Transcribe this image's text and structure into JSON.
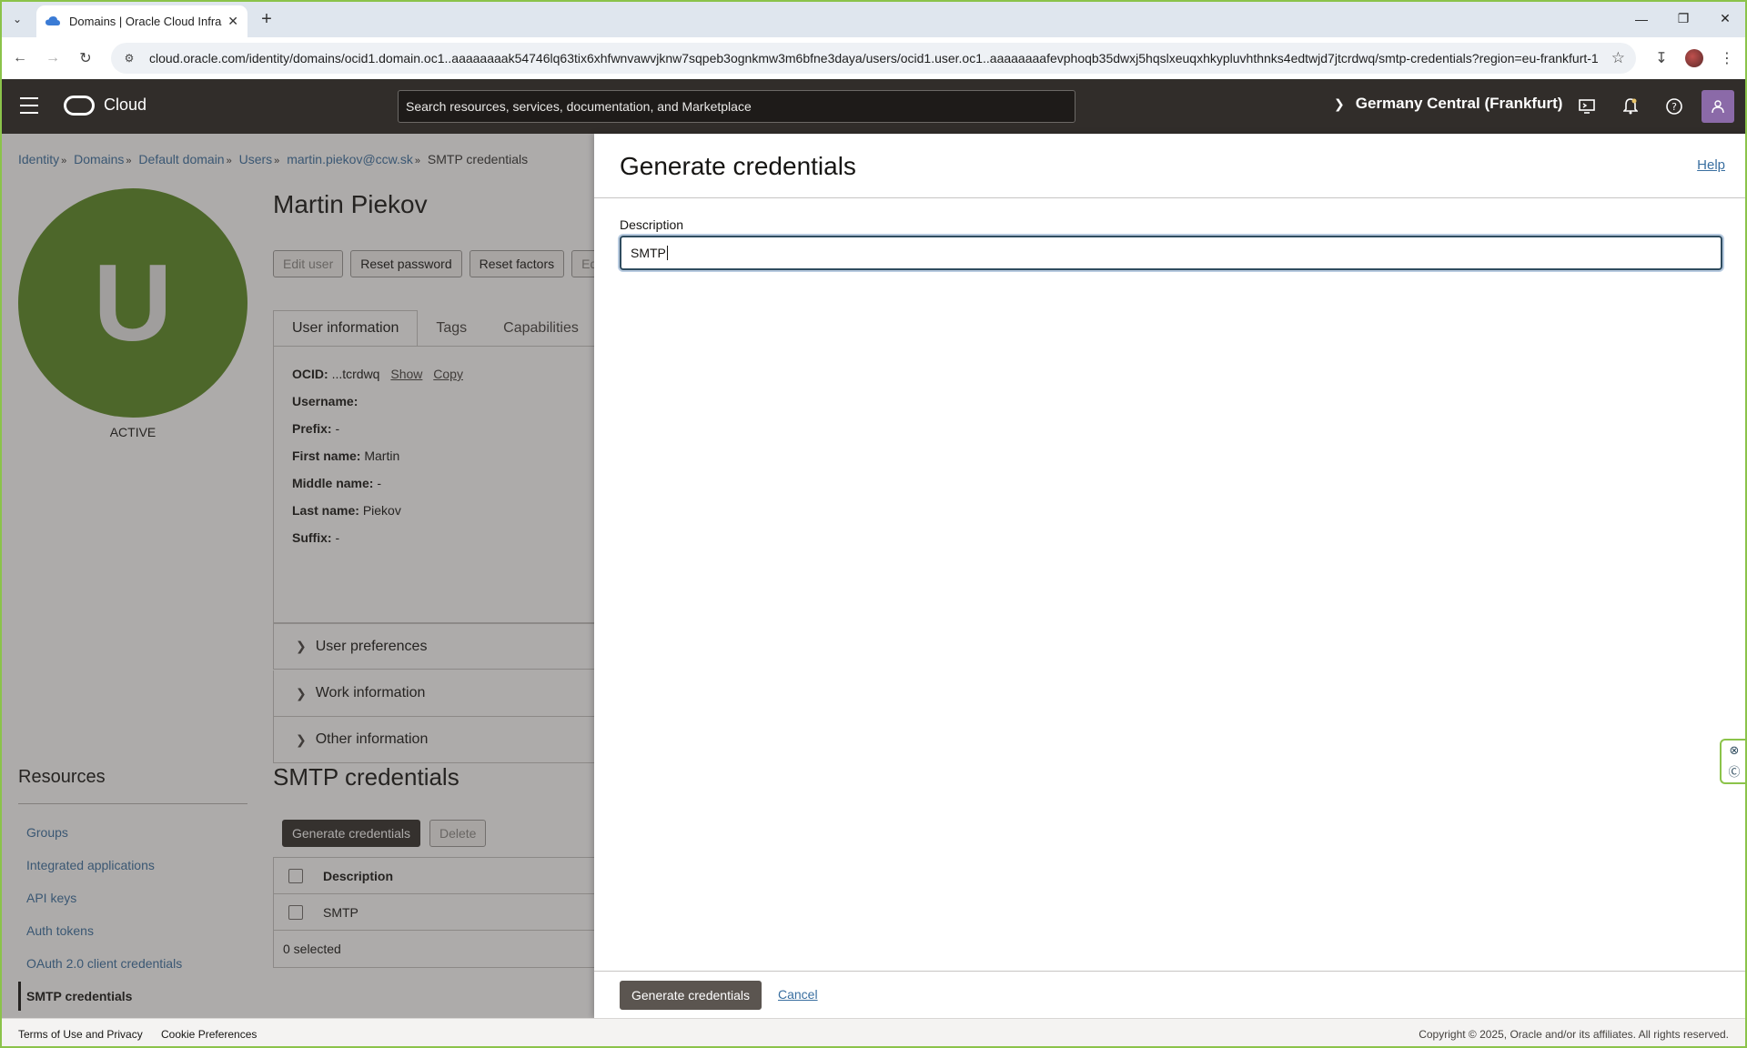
{
  "browser": {
    "tab_title": "Domains | Oracle Cloud Infrastr",
    "url": "cloud.oracle.com/identity/domains/ocid1.domain.oc1..aaaaaaaak54746lq63tix6xhfwnvawvjknw7sqpeb3ognkmw3m6bfne3daya/users/ocid1.user.oc1..aaaaaaaafevphoqb35dwxj5hqslxeuqxhkypluvhthnks4edtwjd7jtcrdwq/smtp-credentials?region=eu-frankfurt-1"
  },
  "header": {
    "brand": "Cloud",
    "search_placeholder": "Search resources, services, documentation, and Marketplace",
    "region": "Germany Central (Frankfurt)"
  },
  "breadcrumb": {
    "items": [
      "Identity",
      "Domains",
      "Default domain",
      "Users",
      "martin.piekov@ccw.sk"
    ],
    "current": "SMTP credentials"
  },
  "user": {
    "avatar_letter": "U",
    "status": "ACTIVE",
    "name": "Martin Piekov",
    "actions": [
      "Edit user",
      "Reset password",
      "Reset factors",
      "Ed"
    ],
    "tabs": [
      "User information",
      "Tags",
      "Capabilities"
    ],
    "info": {
      "ocid_label": "OCID:",
      "ocid_value": "...tcrdwq",
      "show": "Show",
      "copy": "Copy",
      "username_label": "Username:",
      "prefix_label": "Prefix:",
      "prefix_value": "-",
      "first_name_label": "First name:",
      "first_name_value": "Martin",
      "middle_name_label": "Middle name:",
      "middle_name_value": "-",
      "last_name_label": "Last name:",
      "last_name_value": "Piekov",
      "suffix_label": "Suffix:",
      "suffix_value": "-"
    },
    "sections": [
      "User preferences",
      "Work information",
      "Other information"
    ]
  },
  "resources": {
    "title": "Resources",
    "items": [
      "Groups",
      "Integrated applications",
      "API keys",
      "Auth tokens",
      "OAuth 2.0 client credentials",
      "SMTP credentials"
    ]
  },
  "smtp": {
    "title": "SMTP credentials",
    "generate_label": "Generate credentials",
    "delete_label": "Delete",
    "column_description": "Description",
    "rows": [
      "SMTP"
    ],
    "selected_text": "0 selected"
  },
  "drawer": {
    "title": "Generate credentials",
    "help": "Help",
    "description_label": "Description",
    "description_value": "SMTP",
    "submit_label": "Generate credentials",
    "cancel_label": "Cancel"
  },
  "footer": {
    "terms": "Terms of Use and Privacy",
    "cookies": "Cookie Preferences",
    "copyright": "Copyright © 2025, Oracle and/or its affiliates. All rights reserved."
  },
  "colors": {
    "header_bg": "#312d2a",
    "avatar_green": "#5b8a24",
    "link_blue": "#3a6fa0",
    "window_border": "#8bc34a"
  }
}
